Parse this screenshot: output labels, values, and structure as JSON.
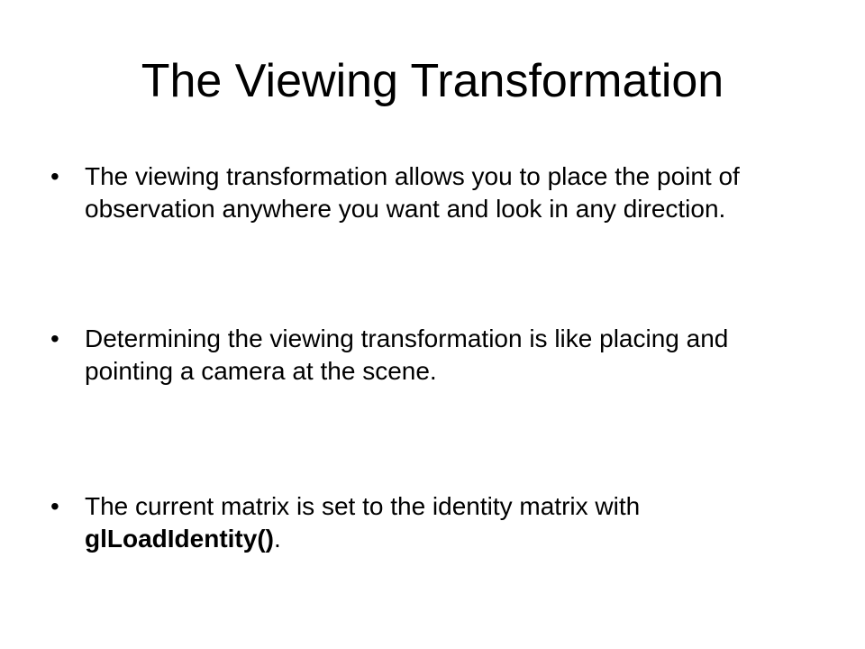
{
  "slide": {
    "title": "The Viewing Transformation",
    "bullet_symbol": "•",
    "bullets": [
      {
        "text": "The viewing transformation allows you to place the point of observation anywhere you want and look in any direction."
      },
      {
        "text": "Determining the viewing transformation is like placing and pointing a camera at the scene."
      },
      {
        "text_before": "The current matrix is set to the identity matrix with ",
        "code": "glLoadIdentity()",
        "text_after": "."
      }
    ]
  }
}
